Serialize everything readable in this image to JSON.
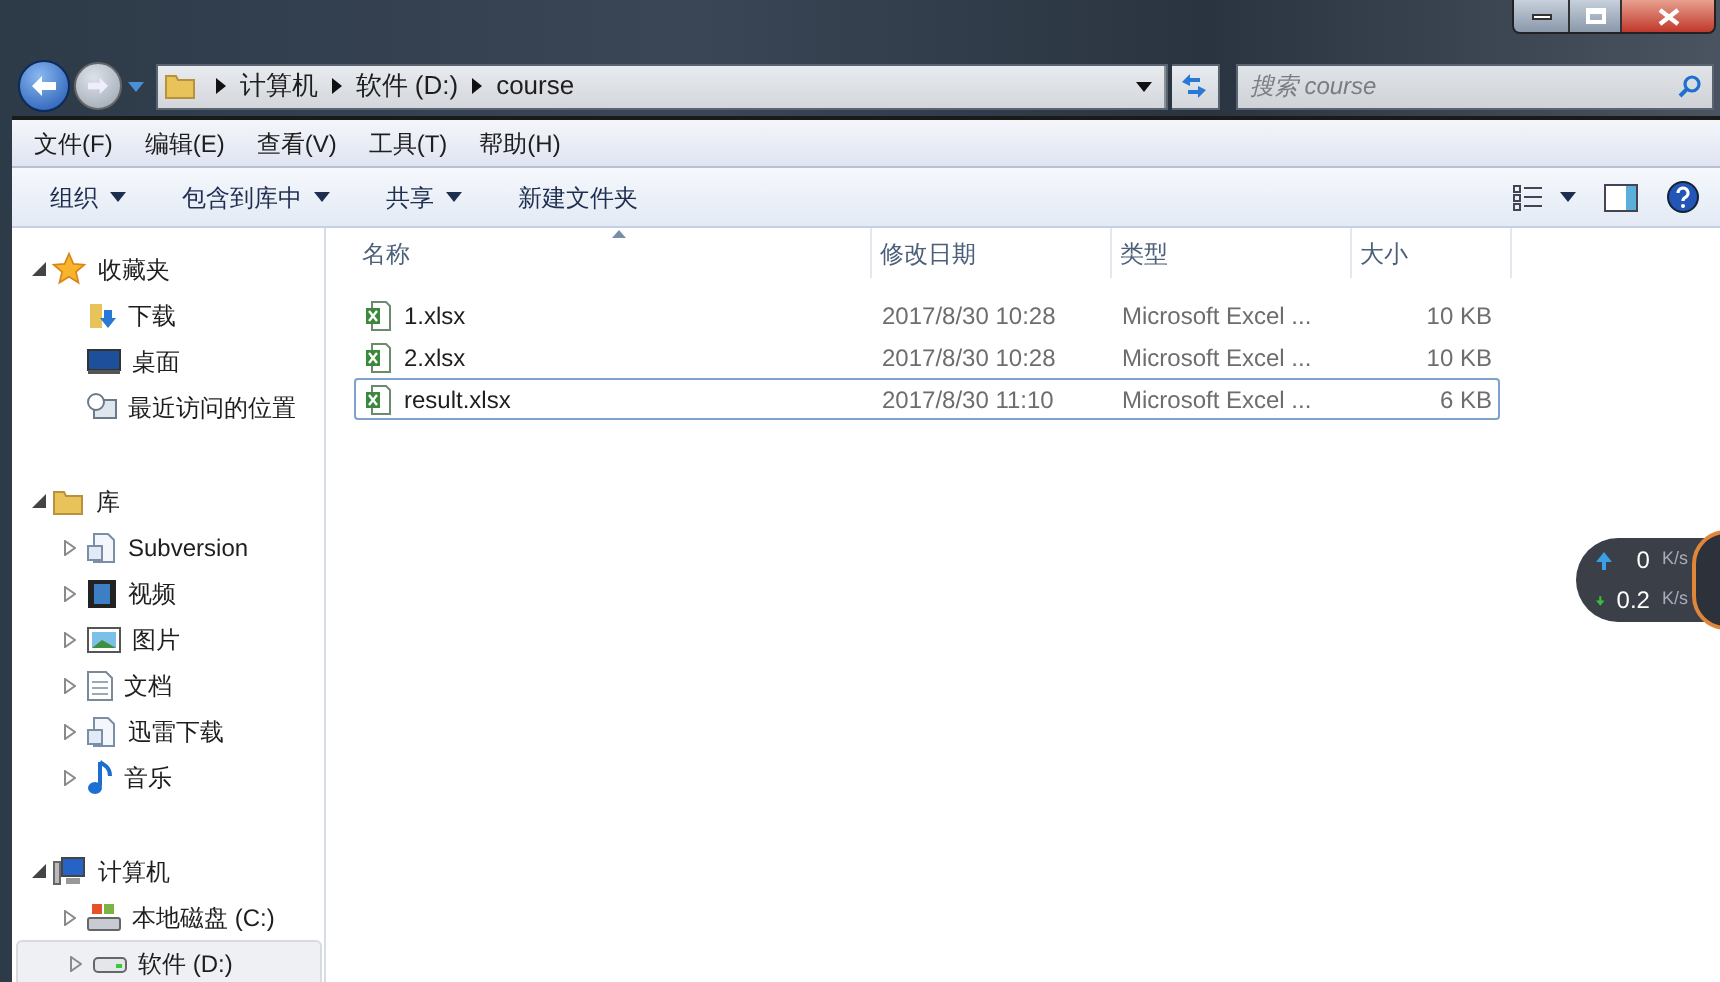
{
  "address": {
    "crumbs": [
      "计算机",
      "软件 (D:)",
      "course"
    ]
  },
  "search": {
    "placeholder": "搜索 course"
  },
  "menu": [
    "文件(F)",
    "编辑(E)",
    "查看(V)",
    "工具(T)",
    "帮助(H)"
  ],
  "toolbar": [
    {
      "label": "组织",
      "has_menu": true
    },
    {
      "label": "包含到库中",
      "has_menu": true
    },
    {
      "label": "共享",
      "has_menu": true
    },
    {
      "label": "新建文件夹",
      "has_menu": false
    }
  ],
  "sidebar": [
    {
      "label": "收藏夹",
      "expanded": true,
      "children": [
        {
          "label": "下载",
          "expandable": false,
          "selected": false
        },
        {
          "label": "桌面",
          "expandable": false,
          "selected": false
        },
        {
          "label": "最近访问的位置",
          "expandable": false,
          "selected": false
        }
      ]
    },
    {
      "label": "库",
      "expanded": true,
      "children": [
        {
          "label": "Subversion",
          "expandable": true,
          "selected": false
        },
        {
          "label": "视频",
          "expandable": true,
          "selected": false
        },
        {
          "label": "图片",
          "expandable": true,
          "selected": false
        },
        {
          "label": "文档",
          "expandable": true,
          "selected": false
        },
        {
          "label": "迅雷下载",
          "expandable": true,
          "selected": false
        },
        {
          "label": "音乐",
          "expandable": true,
          "selected": false
        }
      ]
    },
    {
      "label": "计算机",
      "expanded": true,
      "children": [
        {
          "label": "本地磁盘 (C:)",
          "expandable": true,
          "selected": false
        },
        {
          "label": "软件 (D:)",
          "expandable": true,
          "selected": true
        }
      ]
    }
  ],
  "table": {
    "columns": [
      {
        "label": "名称",
        "sorted": true
      },
      {
        "label": "修改日期",
        "sorted": false
      },
      {
        "label": "类型",
        "sorted": false
      },
      {
        "label": "大小",
        "sorted": false
      }
    ],
    "rows": [
      {
        "name": "1.xlsx",
        "date": "2017/8/30 10:28",
        "type": "Microsoft Excel ...",
        "size": "10 KB",
        "selected": false
      },
      {
        "name": "2.xlsx",
        "date": "2017/8/30 10:28",
        "type": "Microsoft Excel ...",
        "size": "10 KB",
        "selected": false
      },
      {
        "name": "result.xlsx",
        "date": "2017/8/30 11:10",
        "type": "Microsoft Excel ...",
        "size": "6 KB",
        "selected": true
      }
    ]
  },
  "speed_widget": {
    "upload": {
      "value": "0",
      "unit": "K/s"
    },
    "download": {
      "value": "0.2",
      "unit": "K/s"
    }
  }
}
